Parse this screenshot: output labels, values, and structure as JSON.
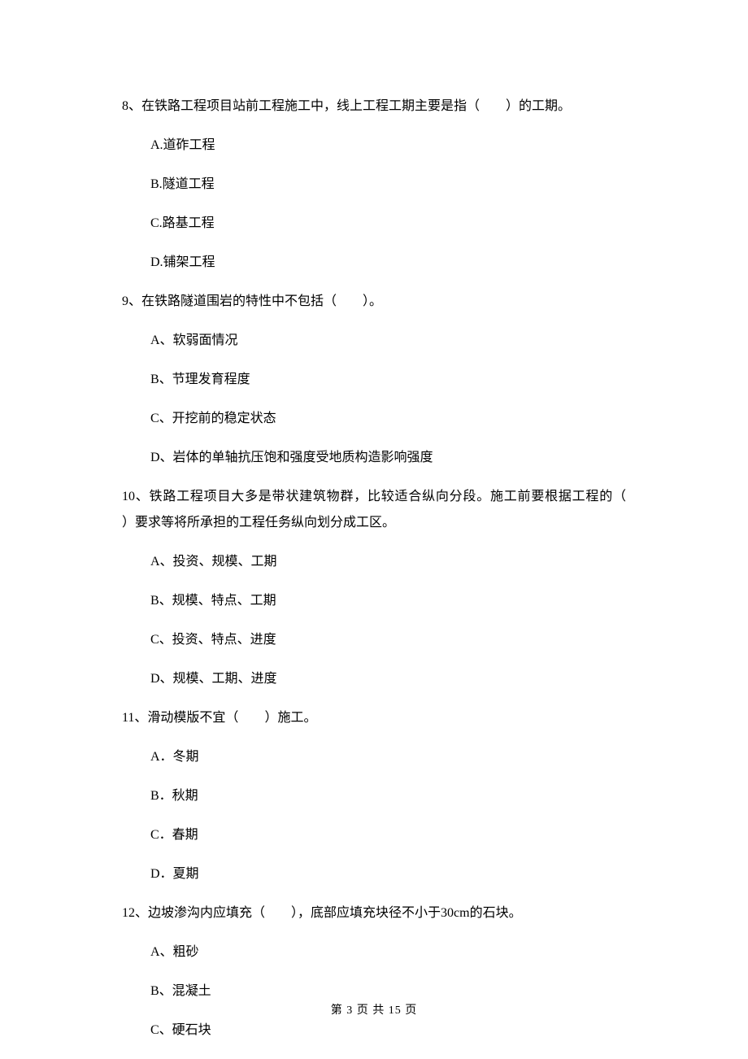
{
  "questions": [
    {
      "stem_before": "8、在铁路工程项目站前工程施工中，线上工程工期主要是指（",
      "stem_after": "）的工期。",
      "options": [
        "A.道砟工程",
        "B.隧道工程",
        "C.路基工程",
        "D.铺架工程"
      ]
    },
    {
      "stem_before": "9、在铁路隧道围岩的特性中不包括（",
      "stem_after": "）。",
      "options": [
        "A、软弱面情况",
        "B、节理发育程度",
        "C、开挖前的稳定状态",
        "D、岩体的单轴抗压饱和强度受地质构造影响强度"
      ]
    },
    {
      "stem_before": "10、铁路工程项目大多是带状建筑物群，比较适合纵向分段。施工前要根据工程的（",
      "stem_after": "）要求等将所承担的工程任务纵向划分成工区。",
      "options": [
        "A、投资、规模、工期",
        "B、规模、特点、工期",
        "C、投资、特点、进度",
        "D、规模、工期、进度"
      ]
    },
    {
      "stem_before": "11、滑动模版不宜（",
      "stem_after": "）施工。",
      "options": [
        "A．冬期",
        "B．秋期",
        "C．春期",
        "D．夏期"
      ]
    },
    {
      "stem_before": "12、边坡渗沟内应填充（",
      "stem_after": "），底部应填充块径不小于30cm的石块。",
      "options": [
        "A、粗砂",
        "B、混凝土",
        "C、硬石块"
      ]
    }
  ],
  "blank": "　　",
  "footer": "第 3 页 共 15 页"
}
